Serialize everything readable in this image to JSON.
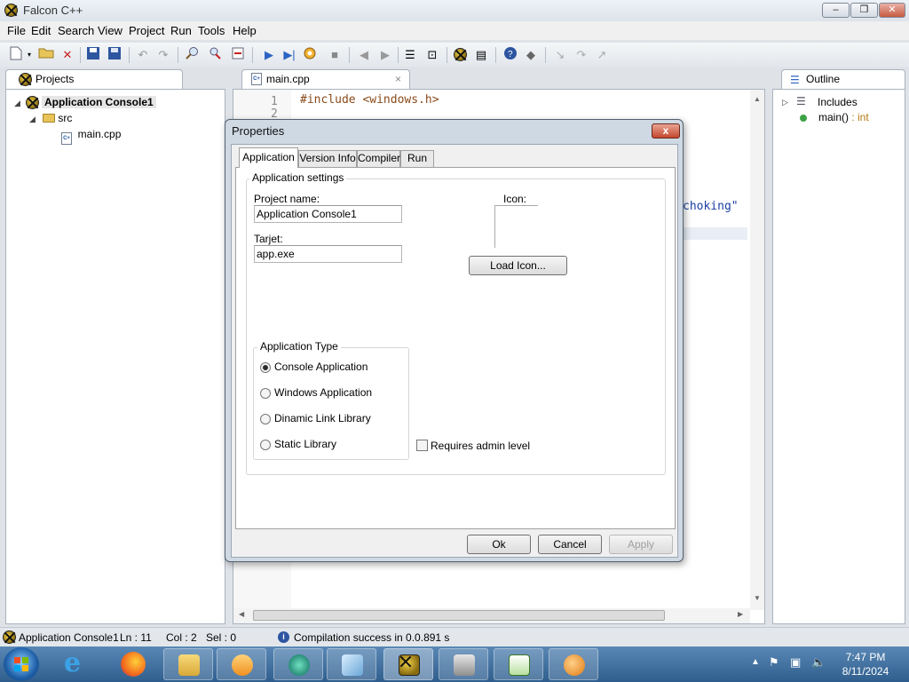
{
  "window": {
    "title": "Falcon C++",
    "min": "–",
    "max": "❐",
    "close": "✕"
  },
  "menu": [
    "File",
    "Edit",
    "Search",
    "View",
    "Project",
    "Run",
    "Tools",
    "Help"
  ],
  "toolbar": {
    "icons": [
      "new-file-icon",
      "dropdown-arrow-icon",
      "open-folder-icon",
      "delete-icon",
      "save-icon",
      "save-all-icon",
      "undo-icon",
      "redo-icon",
      "find-icon",
      "replace-icon",
      "goto-icon",
      "run-icon",
      "step-icon",
      "build-icon",
      "stop-icon",
      "back-icon",
      "forward-icon",
      "list-icon",
      "bookmark-icon",
      "falcon-icon",
      "properties-icon",
      "help-icon",
      "packages-icon",
      "debug1-icon",
      "debug2-icon",
      "debug3-icon"
    ]
  },
  "projects": {
    "tab": "Projects",
    "root": "Application Console1",
    "folder": "src",
    "file": "main.cpp"
  },
  "editor": {
    "tab": "main.cpp",
    "close": "×",
    "lines": [
      {
        "num": "1",
        "text": "#include <windows.h>"
      },
      {
        "num": "2",
        "text": ""
      }
    ],
    "visible_fragment": "choking\""
  },
  "outline": {
    "tab": "Outline",
    "includes": "Includes",
    "func": "main()",
    "func_type": " : int"
  },
  "dialog": {
    "title": "Properties",
    "close": "x",
    "tabs": [
      "Application",
      "Version Info",
      "Compiler",
      "Run"
    ],
    "group_label": "Application settings",
    "project_name_label": "Project name:",
    "project_name_value": "Application Console1",
    "target_label": "Tarjet:",
    "target_value": "app.exe",
    "icon_label": "Icon:",
    "load_icon": "Load Icon...",
    "app_type_label": "Application Type",
    "app_types": [
      "Console Application",
      "Windows Application",
      "Dinamic Link Library",
      "Static Library"
    ],
    "selected_type": "Console Application",
    "requires_admin": "Requires admin level",
    "requires_admin_checked": false,
    "ok": "Ok",
    "cancel": "Cancel",
    "apply": "Apply"
  },
  "status": {
    "project": "Application Console1",
    "ln": "Ln : 11",
    "col": "Col : 2",
    "sel": "Sel : 0",
    "message": "Compilation success in 0.0.891 s"
  },
  "taskbar": {
    "time": "7:47 PM",
    "date": "8/11/2024"
  }
}
